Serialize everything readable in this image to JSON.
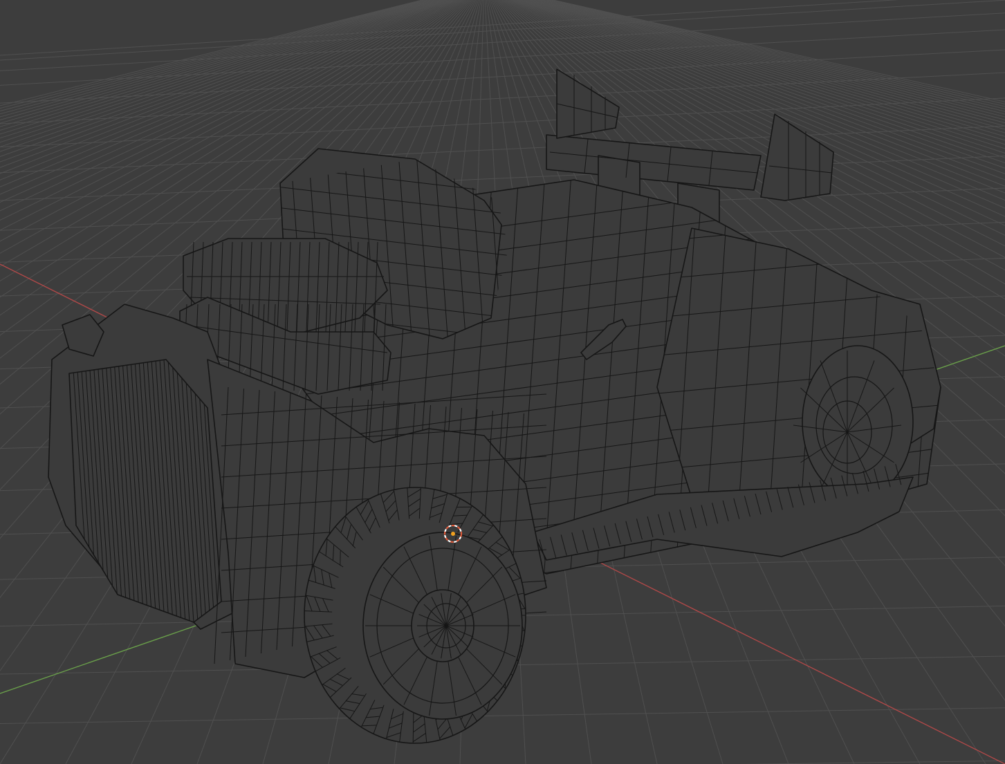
{
  "viewport": {
    "mode": "wireframe",
    "background": "#3d3d3d",
    "grid_color": "#505050",
    "axis_x_color": "#b04848",
    "axis_y_color": "#6aa04a",
    "wire_color": "#161616",
    "object_fill": "#3b3b3b",
    "cursor_colors": [
      "#e05a3a",
      "#ffffff"
    ],
    "origin_color": "#f0a020"
  },
  "scene": {
    "object_kind": "car model",
    "icons": {
      "cursor": "3d-cursor-icon",
      "origin": "object-origin-dot"
    }
  }
}
